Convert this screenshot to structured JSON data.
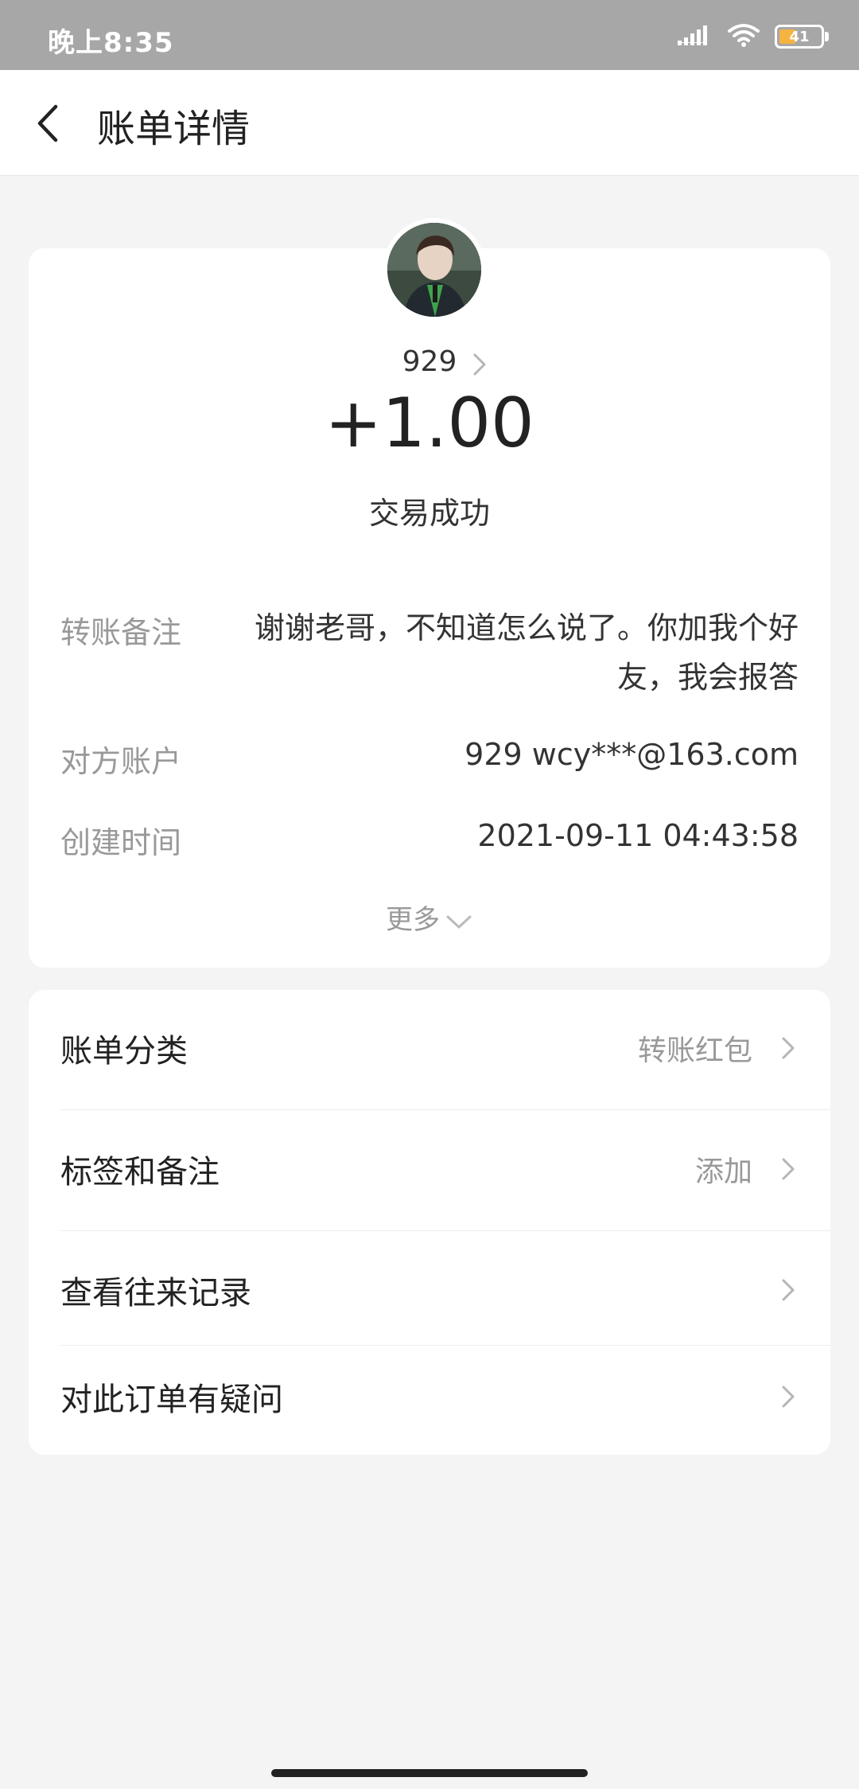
{
  "status_bar": {
    "time": "晚上8:35",
    "battery_level": "41"
  },
  "header": {
    "title": "账单详情"
  },
  "transaction": {
    "counterparty_name": "929",
    "amount": "+1.00",
    "status": "交易成功"
  },
  "details": {
    "memo_label": "转账备注",
    "memo_value": "谢谢老哥，不知道怎么说了。你加我个好友，我会报答",
    "account_label": "对方账户",
    "account_value": "929 wcy***@163.com",
    "created_label": "创建时间",
    "created_value": "2021-09-11 04:43:58",
    "more_label": "更多"
  },
  "menu": {
    "category_label": "账单分类",
    "category_value": "转账红包",
    "tags_label": "标签和备注",
    "tags_value": "添加",
    "history_label": "查看往来记录",
    "question_label": "对此订单有疑问"
  },
  "colors": {
    "status_bar": "#a7a7a7",
    "background": "#f4f4f4",
    "battery_fill": "#f5b342"
  }
}
